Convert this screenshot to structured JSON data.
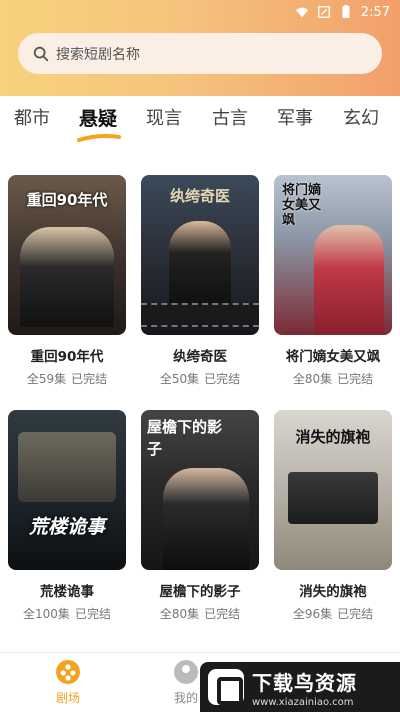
{
  "status": {
    "time": "2:57"
  },
  "search": {
    "placeholder": "搜索短剧名称"
  },
  "tabs": [
    {
      "label": "都市"
    },
    {
      "label": "悬疑"
    },
    {
      "label": "现言"
    },
    {
      "label": "古言"
    },
    {
      "label": "军事"
    },
    {
      "label": "玄幻"
    }
  ],
  "dramas": [
    {
      "title": "重回90年代",
      "episodes": "全59集",
      "status": "已完结",
      "poster_title": "重回90年代"
    },
    {
      "title": "纨绔奇医",
      "episodes": "全50集",
      "status": "已完结",
      "poster_title": "纨绔奇医"
    },
    {
      "title": "将门嫡女美又飒",
      "episodes": "全80集",
      "status": "已完结",
      "poster_title": "将门嫡女美又飒"
    },
    {
      "title": "荒楼诡事",
      "episodes": "全100集",
      "status": "已完结",
      "poster_title": "荒楼诡事"
    },
    {
      "title": "屋檐下的影子",
      "episodes": "全80集",
      "status": "已完结",
      "poster_title": "屋檐下的影子"
    },
    {
      "title": "消失的旗袍",
      "episodes": "全96集",
      "status": "已完结",
      "poster_title": "消失的旗袍"
    }
  ],
  "nav": {
    "theater": "剧场",
    "mine": "我的"
  },
  "watermark": {
    "title": "下载鸟资源",
    "url": "www.xiazainiao.com"
  },
  "colors": {
    "accent": "#f4a31e",
    "header_start": "#f6d27c",
    "header_end": "#f2a06a"
  }
}
